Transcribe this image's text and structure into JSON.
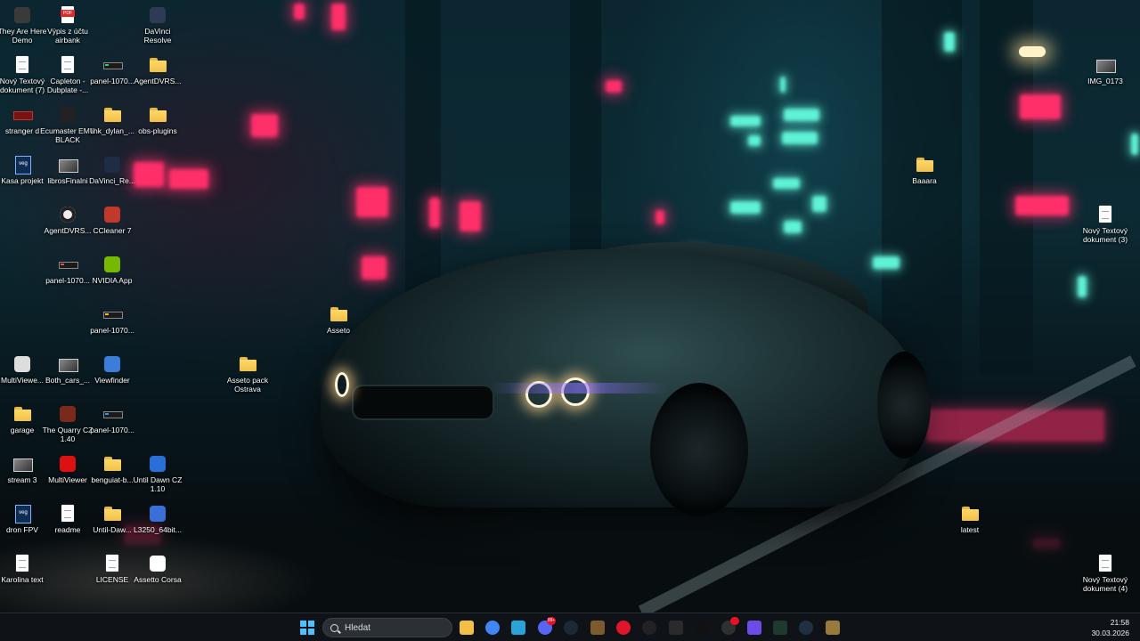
{
  "desktop": {
    "icons": [
      {
        "label": "They Are Here Demo",
        "icon": "game-icon",
        "type": "app",
        "color": "#3a3a3a"
      },
      {
        "label": "Výpis z účtu airbank",
        "icon": "pdf-icon",
        "type": "pdf"
      },
      {
        "label": "DaVinci Resolve",
        "icon": "davinci-icon",
        "type": "app",
        "color": "#2d3b55"
      },
      {
        "label": "Nový Textový dokument (7)",
        "icon": "text-file-icon",
        "type": "doc"
      },
      {
        "label": "Capleton - Dubplate -...",
        "icon": "audio-file-icon",
        "type": "doc"
      },
      {
        "label": "panel-1070...",
        "icon": "panel-image-icon",
        "type": "panel",
        "color": "#2ecc71"
      },
      {
        "label": "AgentDVRS...",
        "icon": "folder-icon",
        "type": "folder"
      },
      {
        "label": "stranger d",
        "icon": "video-thumb-icon",
        "type": "red"
      },
      {
        "label": "Ecumaster EMU BLACK",
        "icon": "ecumaster-icon",
        "type": "app",
        "color": "#222"
      },
      {
        "label": "link_dylan_...",
        "icon": "folder-icon",
        "type": "folder"
      },
      {
        "label": "obs-plugins",
        "icon": "folder-icon",
        "type": "folder"
      },
      {
        "label": "Kasa projekt",
        "icon": "vegas-project-icon",
        "type": "veg"
      },
      {
        "label": "librosFinalni",
        "icon": "image-thumb-icon",
        "type": "thumb"
      },
      {
        "label": "DaVinci_Re...",
        "icon": "davinci-icon",
        "type": "app",
        "color": "#1e2c44"
      },
      {
        "label": "AgentDVRS...",
        "icon": "agentdvr-icon",
        "type": "round",
        "color": "#eee"
      },
      {
        "label": "CCleaner 7",
        "icon": "ccleaner-icon",
        "type": "app",
        "color": "#c0392b"
      },
      {
        "label": "panel-1070...",
        "icon": "panel-image-icon",
        "type": "panel",
        "color": "#e74c3c"
      },
      {
        "label": "NVIDIA App",
        "icon": "nvidia-icon",
        "type": "app",
        "color": "#76b900"
      },
      {
        "label": "panel-1070...",
        "icon": "panel-image-icon",
        "type": "panel",
        "color": "#f1c40f"
      },
      {
        "label": "Asseto",
        "icon": "folder-icon",
        "type": "folder"
      },
      {
        "label": "MultiViewe...",
        "icon": "multiviewer-icon",
        "type": "app",
        "color": "#ddd"
      },
      {
        "label": "Both_cars_...",
        "icon": "image-thumb-icon",
        "type": "thumb"
      },
      {
        "label": "Viewfinder",
        "icon": "viewfinder-icon",
        "type": "app",
        "color": "#3b7dd8"
      },
      {
        "label": "Asseto pack Ostrava",
        "icon": "folder-icon",
        "type": "folder"
      },
      {
        "label": "garage",
        "icon": "folder-icon",
        "type": "folder"
      },
      {
        "label": "The Quarry CZ 1.40",
        "icon": "quarry-icon",
        "type": "app",
        "color": "#7a2a1a"
      },
      {
        "label": "panel-1070...",
        "icon": "panel-image-icon",
        "type": "panel",
        "color": "#3498db"
      },
      {
        "label": "stream 3",
        "icon": "video-thumb-icon",
        "type": "thumb"
      },
      {
        "label": "MultiViewer",
        "icon": "multiviewer-f1-icon",
        "type": "app",
        "color": "#d11"
      },
      {
        "label": "benguiat-b...",
        "icon": "folder-icon",
        "type": "folder"
      },
      {
        "label": "Until Dawn CZ 1.10",
        "icon": "until-dawn-icon",
        "type": "app",
        "color": "#2a6fd8"
      },
      {
        "label": "dron FPV",
        "icon": "vegas-project-icon",
        "type": "veg"
      },
      {
        "label": "readme",
        "icon": "text-file-icon",
        "type": "doc"
      },
      {
        "label": "Until-Daw...",
        "icon": "folder-icon",
        "type": "folder"
      },
      {
        "label": "L3250_64bit...",
        "icon": "installer-icon",
        "type": "app",
        "color": "#3b6fd8"
      },
      {
        "label": "Karolina text",
        "icon": "text-file-icon",
        "type": "doc"
      },
      {
        "label": "LICENSE",
        "icon": "text-file-icon",
        "type": "doc"
      },
      {
        "label": "Assetto Corsa",
        "icon": "assetto-icon",
        "type": "app",
        "color": "#fff"
      },
      {
        "label": "IMG_0173",
        "icon": "image-thumb-icon",
        "type": "thumb"
      },
      {
        "label": "Baaara",
        "icon": "folder-icon",
        "type": "folder"
      },
      {
        "label": "Nový Textový dokument (3)",
        "icon": "text-file-icon",
        "type": "doc"
      },
      {
        "label": "latest",
        "icon": "folder-icon",
        "type": "folder"
      },
      {
        "label": "Nový Textový dokument (4)",
        "icon": "text-file-icon",
        "type": "doc"
      }
    ]
  },
  "taskbar": {
    "search_placeholder": "Hledat",
    "apps": [
      {
        "name": "file-explorer-icon",
        "color": "#f2c046"
      },
      {
        "name": "chrome-icon",
        "color": "#4285f4",
        "circle": true
      },
      {
        "name": "desktop-app-icon",
        "color": "#2aa3d8"
      },
      {
        "name": "discord-icon",
        "color": "#5865f2",
        "circle": true,
        "badge": "99+"
      },
      {
        "name": "steam-icon",
        "color": "#1b2838",
        "circle": true
      },
      {
        "name": "game-tile-icon",
        "color": "#7a5c2e"
      },
      {
        "name": "opera-icon",
        "color": "#e0142a",
        "circle": true
      },
      {
        "name": "chatgpt-icon",
        "color": "#222",
        "circle": true
      },
      {
        "name": "epic-games-icon",
        "color": "#2a2a2a"
      },
      {
        "name": "circle-app-icon",
        "color": "#111",
        "circle": true
      },
      {
        "name": "obs-icon",
        "color": "#303030",
        "circle": true,
        "badge": ""
      },
      {
        "name": "grid-app-icon",
        "color": "#6b4ce6"
      },
      {
        "name": "terminal-icon",
        "color": "#1e3a2e"
      },
      {
        "name": "anchor-app-icon",
        "color": "#203040",
        "circle": true
      },
      {
        "name": "game-character-icon",
        "color": "#9a7a3a"
      }
    ],
    "time": "21:58",
    "date": "30.03.2026"
  }
}
